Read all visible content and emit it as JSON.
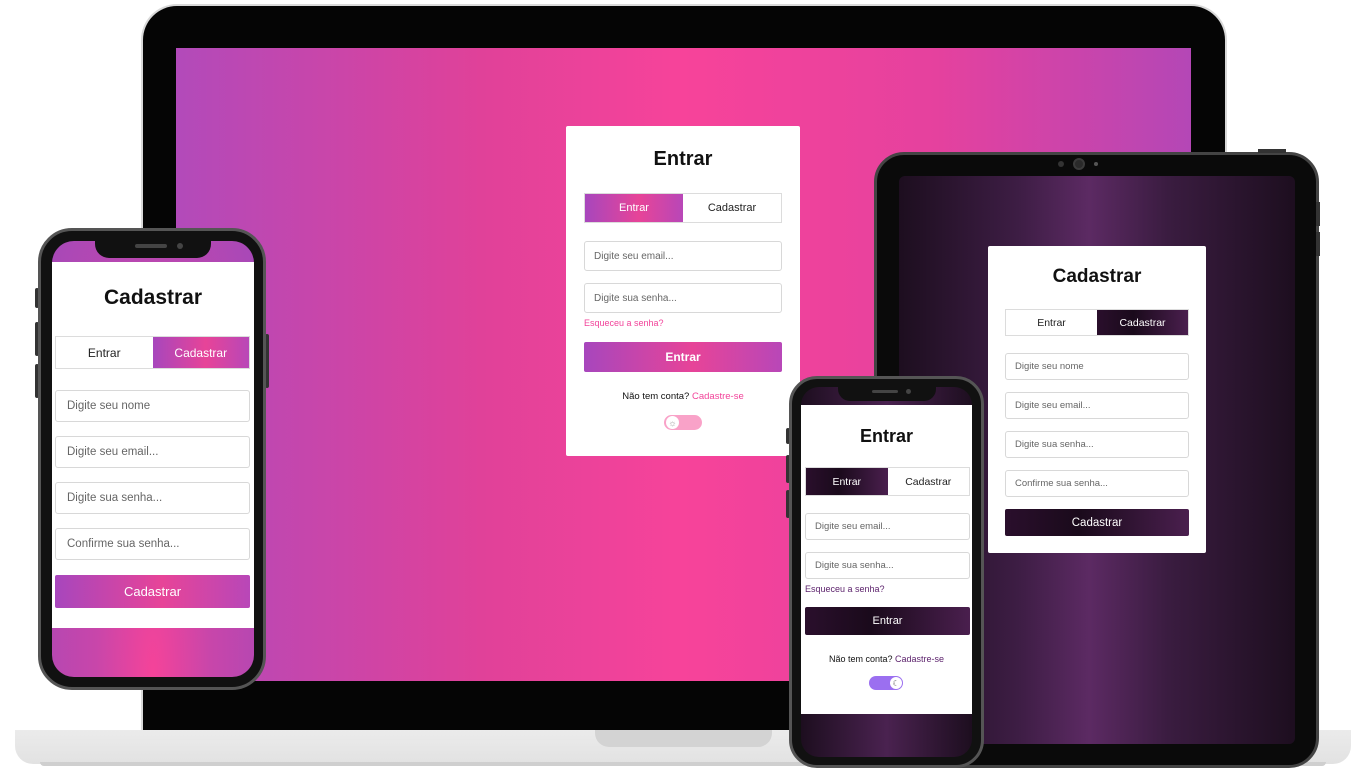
{
  "laptop": {
    "title": "Entrar",
    "tabs": {
      "login": "Entrar",
      "register": "Cadastrar"
    },
    "email_placeholder": "Digite seu email...",
    "password_placeholder": "Digite sua senha...",
    "forgot_link": "Esqueceu a senha?",
    "submit_label": "Entrar",
    "signup_prompt": "Não tem conta?",
    "signup_link": "Cadastre-se",
    "theme_toggle": {
      "state": "light",
      "icon": "sun-icon"
    }
  },
  "tablet": {
    "title": "Cadastrar",
    "tabs": {
      "login": "Entrar",
      "register": "Cadastrar"
    },
    "name_placeholder": "Digite seu nome",
    "email_placeholder": "Digite seu email...",
    "password_placeholder": "Digite sua senha...",
    "confirm_placeholder": "Confirme sua senha...",
    "submit_label": "Cadastrar"
  },
  "phone_left": {
    "title": "Cadastrar",
    "tabs": {
      "login": "Entrar",
      "register": "Cadastrar"
    },
    "name_placeholder": "Digite seu nome",
    "email_placeholder": "Digite seu email...",
    "password_placeholder": "Digite sua senha...",
    "confirm_placeholder": "Confirme sua senha...",
    "submit_label": "Cadastrar"
  },
  "phone_right": {
    "title": "Entrar",
    "tabs": {
      "login": "Entrar",
      "register": "Cadastrar"
    },
    "email_placeholder": "Digite seu email...",
    "password_placeholder": "Digite sua senha...",
    "forgot_link": "Esqueceu a senha?",
    "submit_label": "Entrar",
    "signup_prompt": "Não tem conta?",
    "signup_link": "Cadastre-se",
    "theme_toggle": {
      "state": "dark",
      "icon": "moon-icon"
    }
  },
  "colors": {
    "pink_accent": "#f2439a",
    "purple_accent": "#a746bd",
    "dark_accent": "#2a0f2c",
    "dark_link": "#5a1f6a",
    "toggle_dark": "#9b6ff0"
  }
}
